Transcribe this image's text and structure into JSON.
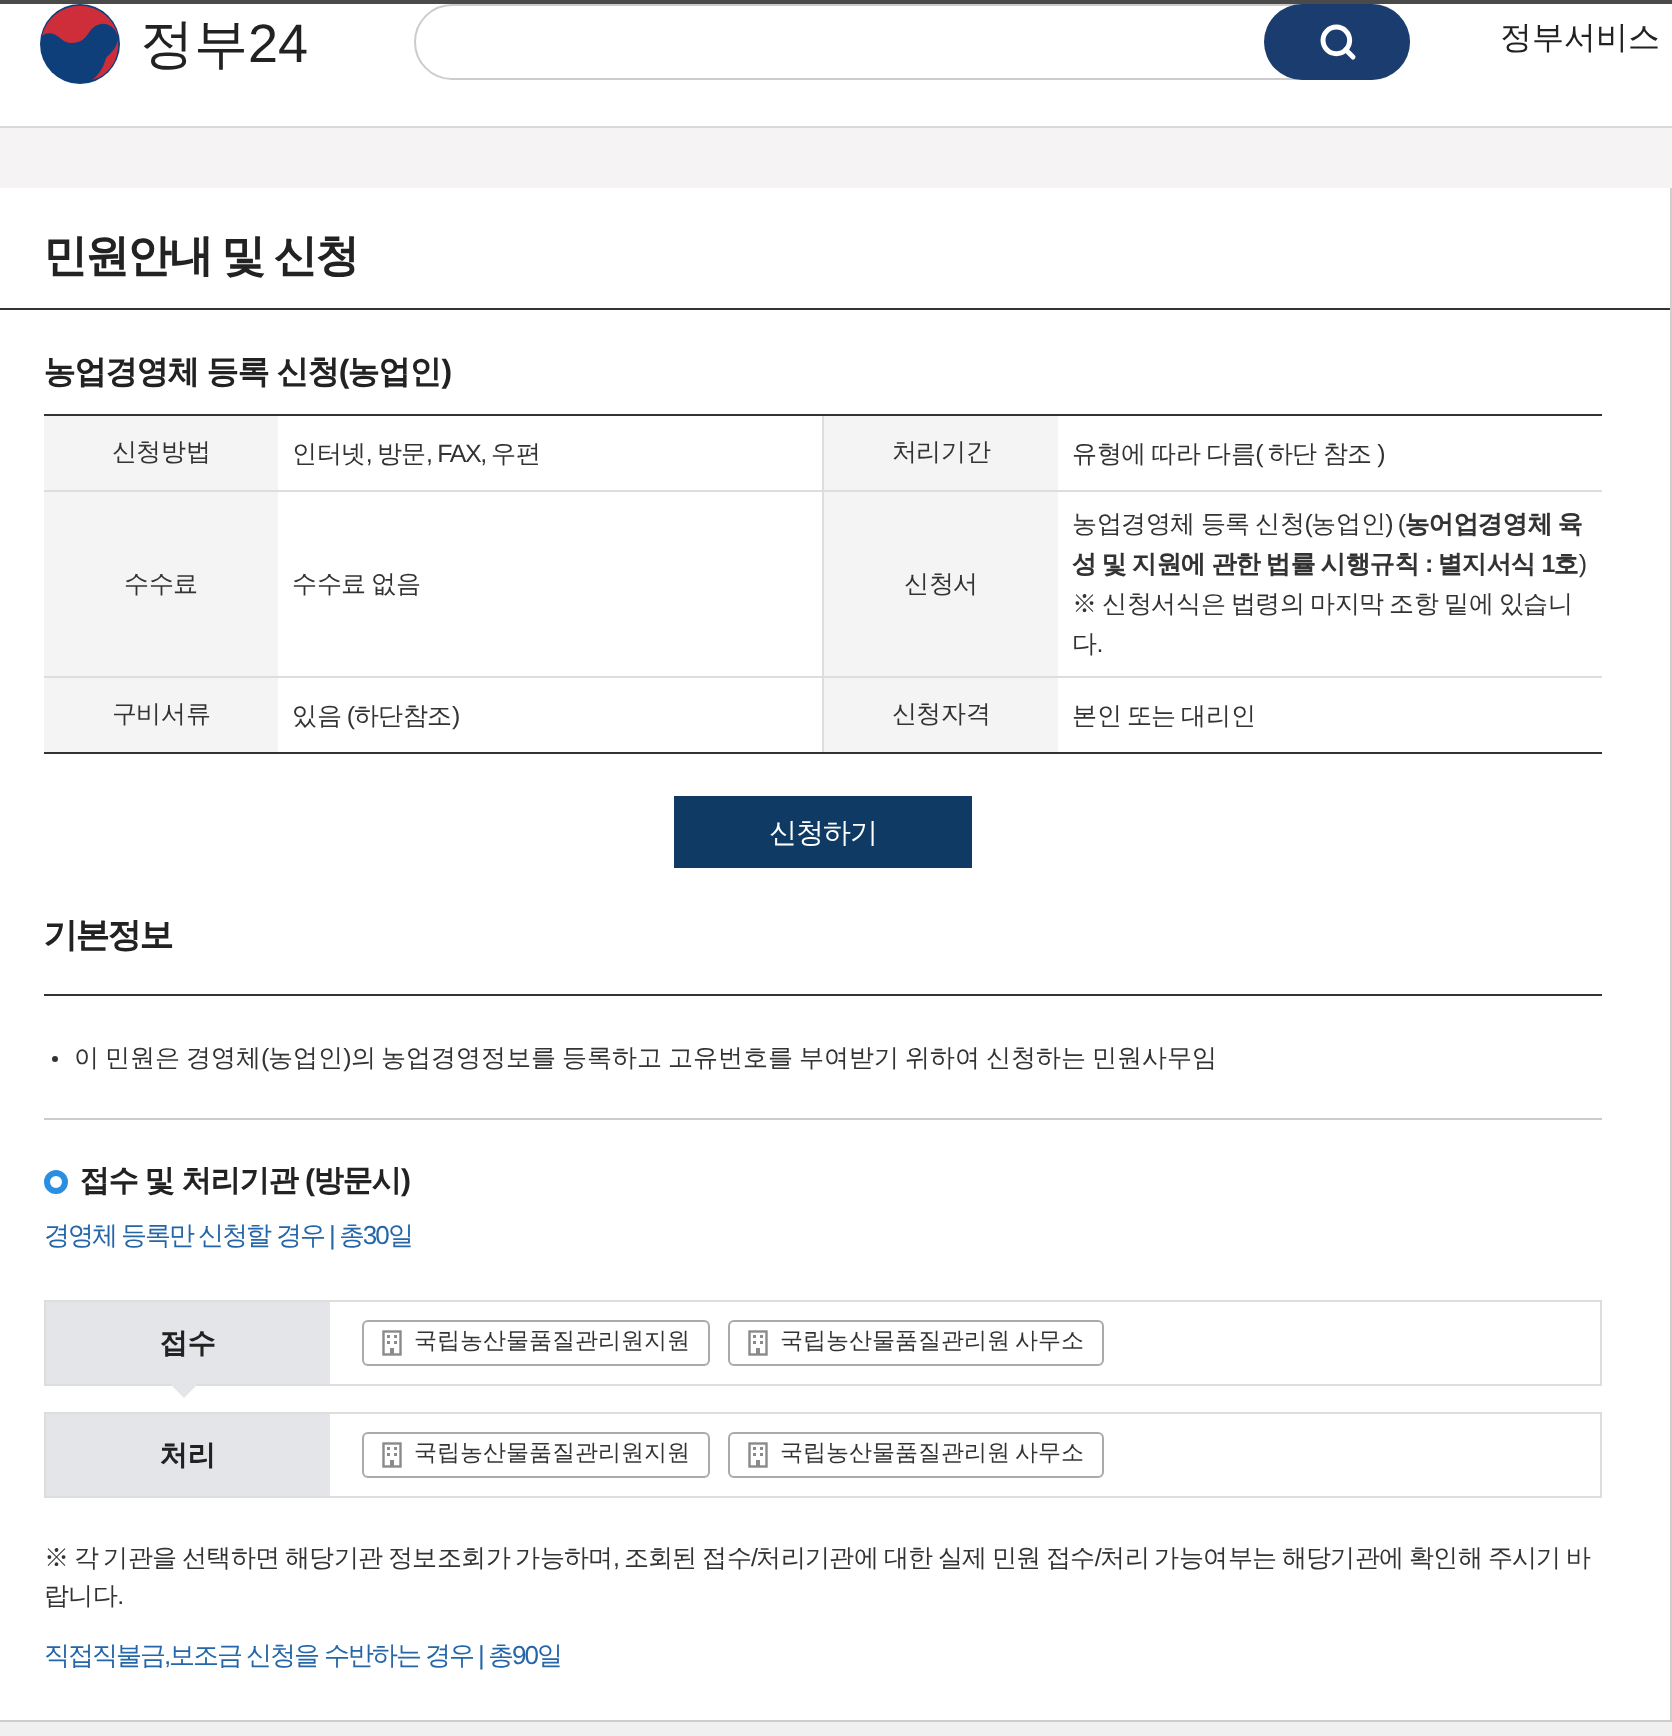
{
  "header": {
    "logo_text": "정부24",
    "nav_item": "정부서비스"
  },
  "page_title": "민원안내 및 신청",
  "service": {
    "title": "농업경영체 등록 신청(농업인)",
    "rows": [
      [
        {
          "label": "신청방법",
          "value": "인터넷, 방문, FAX, 우편"
        },
        {
          "label": "처리기간",
          "value": "유형에 따라 다름( 하단 참조 )"
        }
      ],
      [
        {
          "label": "수수료",
          "value": "수수료 없음"
        },
        {
          "label": "신청서",
          "value": "농업경영체 등록 신청(농업인) (**농어업경영체 육성 및 지원에 관한 법률 시행규칙 : 별지서식 1호**)",
          "note": "※ 신청서식은 법령의 마지막 조항 밑에 있습니다."
        }
      ],
      [
        {
          "label": "구비서류",
          "value": "있음 (하단참조)"
        },
        {
          "label": "신청자격",
          "value": "본인 또는 대리인"
        }
      ]
    ],
    "apply_button": "신청하기"
  },
  "basic_info": {
    "title": "기본정보",
    "bullets": [
      "이 민원은 경영체(농업인)의 농업경영정보를 등록하고 고유번호를 부여받기 위하여 신청하는 민원사무임"
    ]
  },
  "offices": {
    "title": "접수 및 처리기관 (방문시)",
    "cases": [
      {
        "title": "경영체 등록만 신청할 경우 | 총30일",
        "rows": [
          {
            "label": "접수",
            "offices": [
              "국립농산물품질관리원지원",
              "국립농산물품질관리원 사무소"
            ]
          },
          {
            "label": "처리",
            "offices": [
              "국립농산물품질관리원지원",
              "국립농산물품질관리원 사무소"
            ]
          }
        ],
        "note": "※ 각 기관을 선택하면 해당기관 정보조회가 가능하며, 조회된 접수/처리기관에 대한 실제 민원 접수/처리 가능여부는 해당기관에 확인해 주시기 바랍니다."
      },
      {
        "title": "직접직불금,보조금 신청을 수반하는 경우 | 총90일"
      }
    ]
  }
}
